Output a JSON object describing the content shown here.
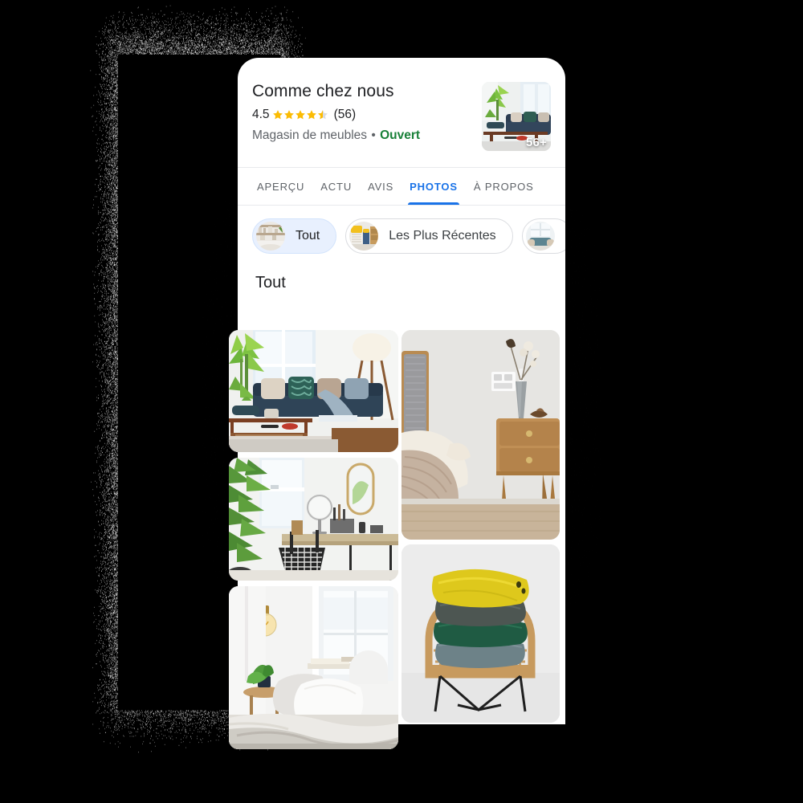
{
  "business": {
    "name": "Comme chez nous",
    "rating_value": "4.5",
    "rating_stars": 4.5,
    "rating_count": "(56)",
    "category": "Magasin de meubles",
    "separator": "•",
    "status": "Ouvert",
    "status_color": "#188038",
    "thumbnail_badge": "56+",
    "thumbnail_icon": "living-room-photo-thumbnail"
  },
  "tabs": [
    {
      "label": "APERÇU",
      "active": false,
      "name": "tab-apercu"
    },
    {
      "label": "ACTU",
      "active": false,
      "name": "tab-actu"
    },
    {
      "label": "AVIS",
      "active": false,
      "name": "tab-avis"
    },
    {
      "label": "PHOTOS",
      "active": true,
      "name": "tab-photos"
    },
    {
      "label": "À PROPOS",
      "active": false,
      "name": "tab-a-propos"
    }
  ],
  "tab_active_color": "#1a73e8",
  "chips": [
    {
      "label": "Tout",
      "selected": true,
      "thumb": "shelf-decor-thumbnail"
    },
    {
      "label": "Les Plus Récentes",
      "selected": false,
      "thumb": "yellow-chair-thumbnail"
    },
    {
      "label": "",
      "selected": false,
      "thumb": "sofa-window-thumbnail"
    }
  ],
  "chip_selected_bg": "#e8f0fe",
  "section": {
    "title": "Tout"
  },
  "photos": [
    {
      "name": "photo-living-room-sofa",
      "alt": "Living room with blue sofa, plants and coffee table"
    },
    {
      "name": "photo-desk-plants-mirror",
      "alt": "Desk with wire chair, mirror and large palm plants"
    },
    {
      "name": "photo-bedroom-white-linen",
      "alt": "Bedroom with white pillows, pendant bulb and linen bedding"
    },
    {
      "name": "photo-nightstand-wood",
      "alt": "Wooden nightstand next to upholstered bed headboard"
    },
    {
      "name": "photo-stacked-cushions",
      "alt": "Stacked yellow, grey and green cushions on rattan chair"
    }
  ],
  "colors": {
    "background": "#000000",
    "card": "#ffffff",
    "accent": "#1a73e8",
    "star": "#fbbc04",
    "text_primary": "#202124",
    "text_secondary": "#5f6368"
  }
}
